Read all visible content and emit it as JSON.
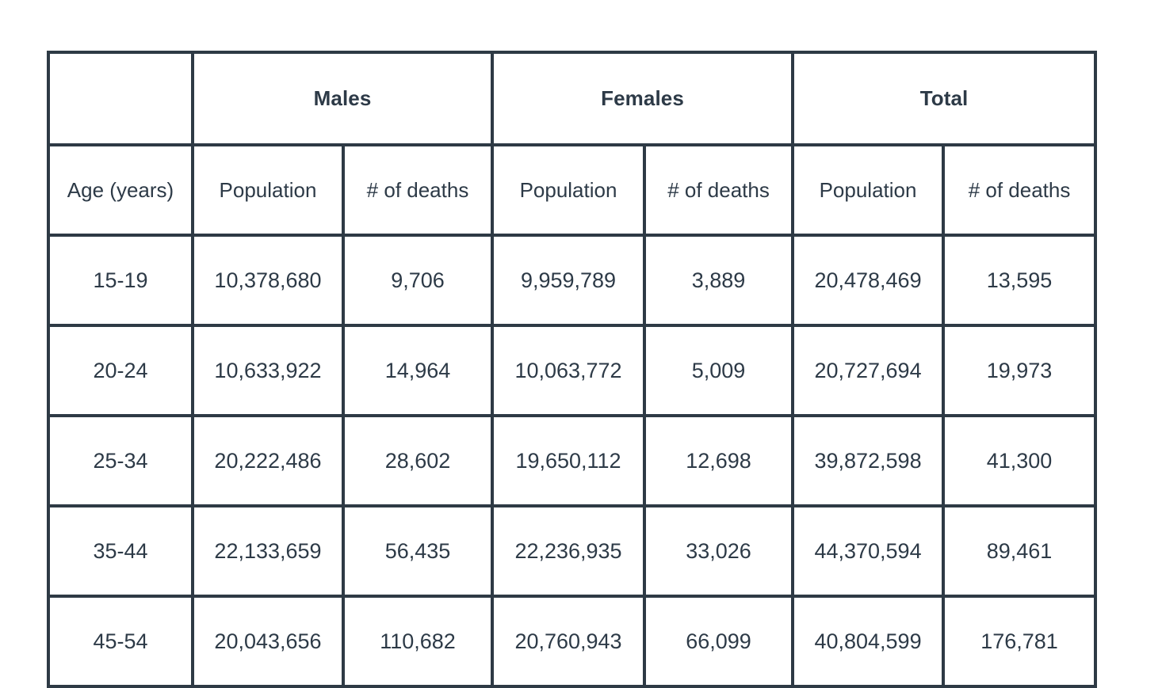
{
  "table": {
    "corner_label": "",
    "groups": [
      {
        "label": "Males"
      },
      {
        "label": "Females"
      },
      {
        "label": "Total"
      }
    ],
    "columns": [
      {
        "key": "age",
        "label": "Age (years)"
      },
      {
        "key": "males_population",
        "label": "Population"
      },
      {
        "key": "males_deaths",
        "label": "# of deaths"
      },
      {
        "key": "females_population",
        "label": "Population"
      },
      {
        "key": "females_deaths",
        "label": "# of deaths"
      },
      {
        "key": "total_population",
        "label": "Population"
      },
      {
        "key": "total_deaths",
        "label": "# of deaths"
      }
    ],
    "rows": [
      {
        "age": "15-19",
        "males_population": "10,378,680",
        "males_deaths": "9,706",
        "females_population": "9,959,789",
        "females_deaths": "3,889",
        "total_population": "20,478,469",
        "total_deaths": "13,595"
      },
      {
        "age": "20-24",
        "males_population": "10,633,922",
        "males_deaths": "14,964",
        "females_population": "10,063,772",
        "females_deaths": "5,009",
        "total_population": "20,727,694",
        "total_deaths": "19,973"
      },
      {
        "age": "25-34",
        "males_population": "20,222,486",
        "males_deaths": "28,602",
        "females_population": "19,650,112",
        "females_deaths": "12,698",
        "total_population": "39,872,598",
        "total_deaths": "41,300"
      },
      {
        "age": "35-44",
        "males_population": "22,133,659",
        "males_deaths": "56,435",
        "females_population": "22,236,935",
        "females_deaths": "33,026",
        "total_population": "44,370,594",
        "total_deaths": "89,461"
      },
      {
        "age": "45-54",
        "males_population": "20,043,656",
        "males_deaths": "110,682",
        "females_population": "20,760,943",
        "females_deaths": "66,099",
        "total_population": "40,804,599",
        "total_deaths": "176,781"
      }
    ]
  },
  "colors": {
    "border": "#2e3a45",
    "text": "#2d3a47",
    "cell_background": "#ffffff",
    "page_background": "#ffffff"
  },
  "chart_data": {
    "type": "table",
    "title": "",
    "categories": [
      "15-19",
      "20-24",
      "25-34",
      "35-44",
      "45-54"
    ],
    "xlabel": "Age (years)",
    "ylabel": "",
    "series": [
      {
        "name": "Males Population",
        "values": [
          10378680,
          10633922,
          20222486,
          22133659,
          20043656
        ]
      },
      {
        "name": "Males # of deaths",
        "values": [
          9706,
          14964,
          28602,
          56435,
          110682
        ]
      },
      {
        "name": "Females Population",
        "values": [
          9959789,
          10063772,
          19650112,
          22236935,
          20760943
        ]
      },
      {
        "name": "Females # of deaths",
        "values": [
          3889,
          5009,
          12698,
          33026,
          66099
        ]
      },
      {
        "name": "Total Population",
        "values": [
          20478469,
          20727694,
          39872598,
          44370594,
          40804599
        ]
      },
      {
        "name": "Total # of deaths",
        "values": [
          13595,
          19973,
          41300,
          89461,
          176781
        ]
      }
    ]
  }
}
